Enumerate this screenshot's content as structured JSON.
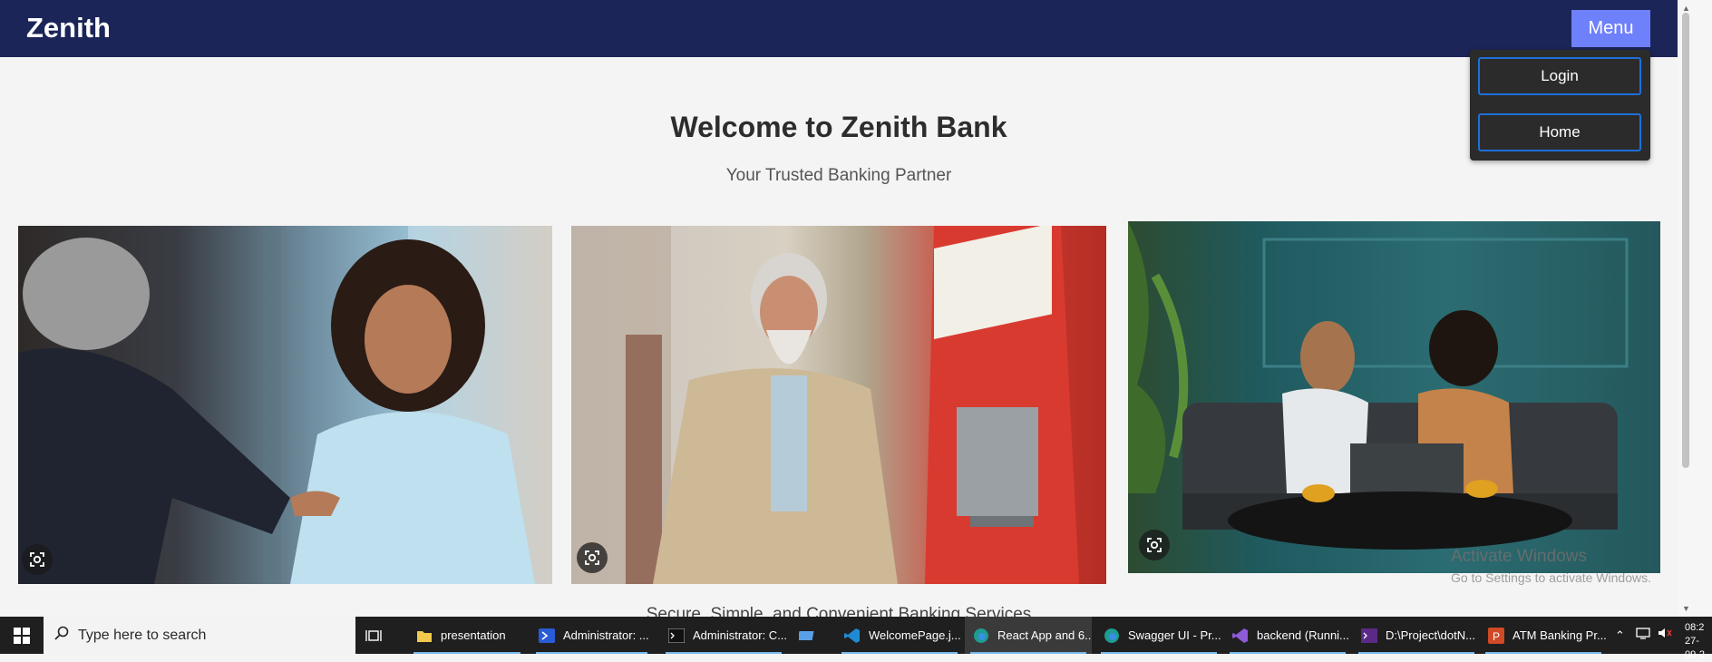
{
  "app": {
    "brand": "Zenith",
    "menu_label": "Menu",
    "dropdown": {
      "login_label": "Login",
      "home_label": "Home"
    }
  },
  "hero": {
    "title": "Welcome to Zenith Bank",
    "tagline": "Your Trusted Banking Partner"
  },
  "photos": [
    {
      "alt": "Banker shaking hands with a customer"
    },
    {
      "alt": "Man withdrawing cash at an ATM"
    },
    {
      "alt": "Two women talking at a table with a laptop"
    }
  ],
  "services_heading": "Secure, Simple, and Convenient Banking Services",
  "watermark": {
    "title": "Activate Windows",
    "subtitle": "Go to Settings to activate Windows."
  },
  "taskbar": {
    "search_placeholder": "Type here to search",
    "items": [
      {
        "label": "presentation",
        "icon": "folder-icon"
      },
      {
        "label": "Administrator: ...",
        "icon": "powershell-icon"
      },
      {
        "label": "Administrator: C...",
        "icon": "cmd-icon"
      },
      {
        "label": "WelcomePage.j...",
        "icon": "vscode-icon"
      },
      {
        "label": "React App and 6...",
        "icon": "edge-icon"
      },
      {
        "label": "Swagger UI - Pr...",
        "icon": "edge-icon"
      },
      {
        "label": "backend (Runni...",
        "icon": "visual-studio-icon"
      },
      {
        "label": "D:\\Project\\dotN...",
        "icon": "terminal-icon"
      },
      {
        "label": "ATM Banking Pr...",
        "icon": "powerpoint-icon"
      }
    ],
    "clock": {
      "time": "08:2",
      "date": "27-09-2"
    }
  },
  "colors": {
    "navbar": "#1b2557",
    "menu_button": "#6f80fb",
    "dropdown_bg": "#2b2b2b",
    "dropdown_border": "#1e6fd9",
    "page_bg": "#f4f4f4",
    "taskbar": "#1f1f1f"
  }
}
